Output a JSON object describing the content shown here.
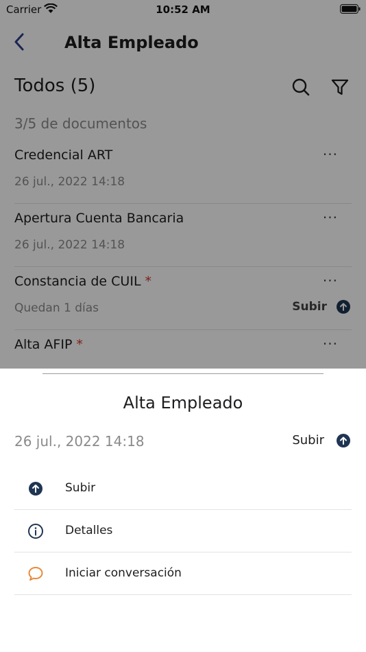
{
  "status_bar": {
    "carrier": "Carrier",
    "time": "10:52 AM"
  },
  "nav": {
    "title": "Alta Empleado",
    "back_icon": "chevron-left-icon"
  },
  "section": {
    "heading": "Todos (5)",
    "search_icon": "search-icon",
    "filter_icon": "filter-icon"
  },
  "count_text": "3/5 de documentos",
  "documents": [
    {
      "name": "Credencial ART",
      "required": false,
      "subtitle": "26 jul., 2022 14:18",
      "more": "···"
    },
    {
      "name": "Apertura Cuenta Bancaria",
      "required": false,
      "subtitle": "26 jul., 2022 14:18",
      "more": "···"
    },
    {
      "name": "Constancia de CUIL",
      "required": true,
      "required_mark": "*",
      "subtitle": "Quedan 1 días",
      "more": "···",
      "upload_label": "Subir"
    },
    {
      "name": "Alta AFIP",
      "required": true,
      "required_mark": "*",
      "more": "···"
    }
  ],
  "sheet": {
    "title": "Alta Empleado",
    "date": "26 jul., 2022 14:18",
    "upload_label": "Subir",
    "actions": [
      {
        "label": "Subir",
        "icon": "upload-circle-icon"
      },
      {
        "label": "Detalles",
        "icon": "info-icon"
      },
      {
        "label": "Iniciar conversación",
        "icon": "chat-bubble-icon"
      }
    ]
  },
  "colors": {
    "accent": "#1f3553",
    "required": "#d0362b",
    "chat": "#e8893a",
    "muted": "#8a8a8a",
    "back": "#2c3f8c"
  }
}
